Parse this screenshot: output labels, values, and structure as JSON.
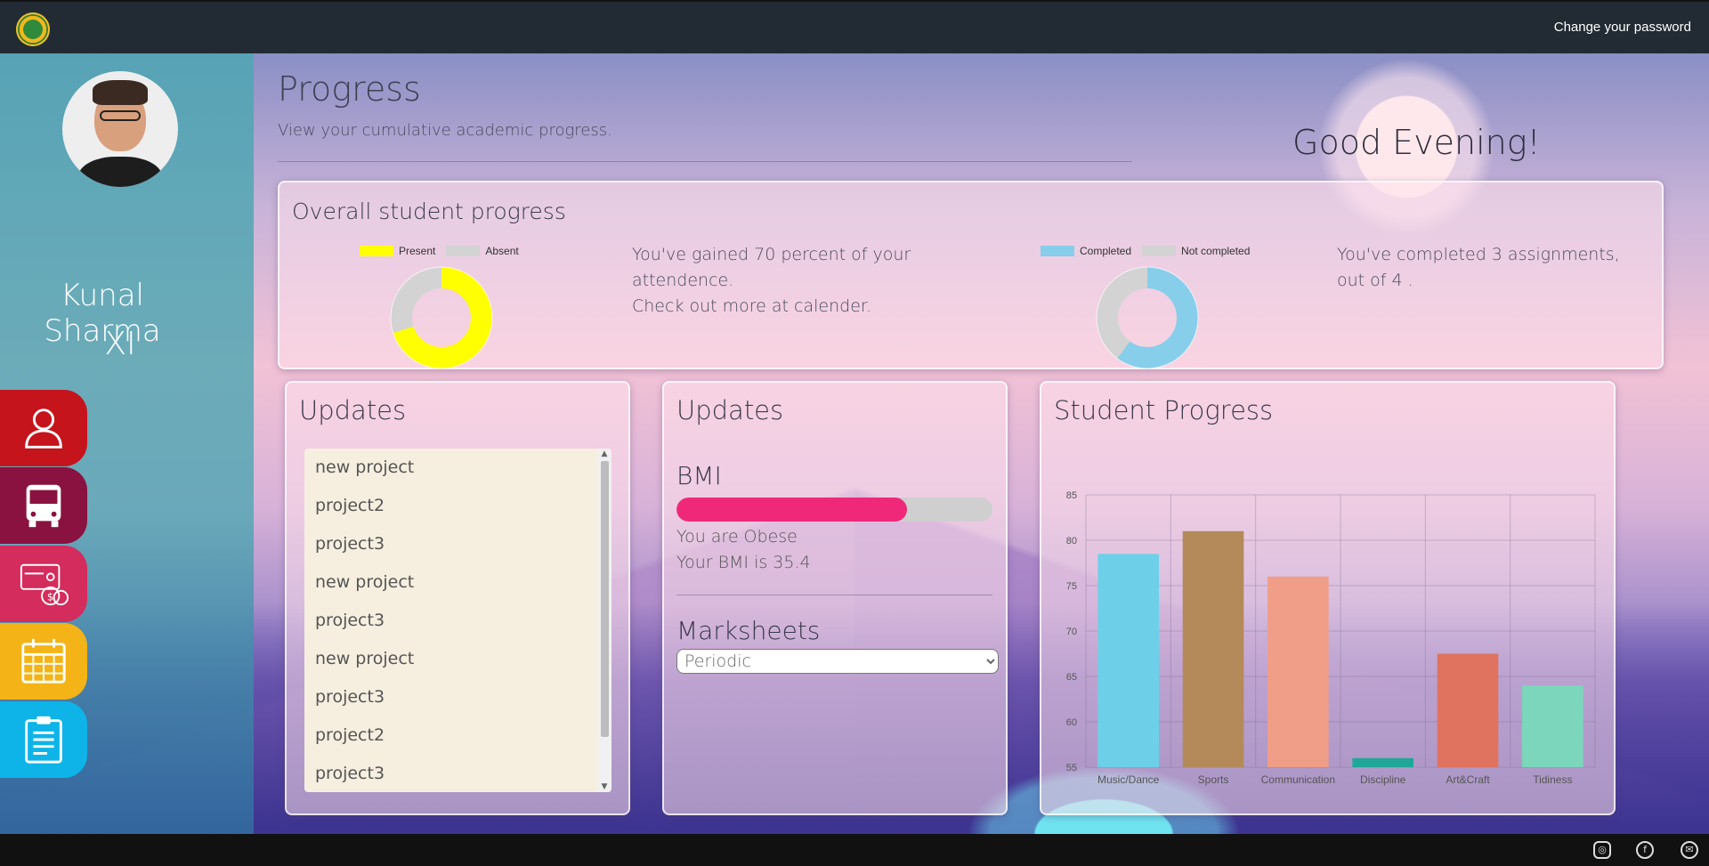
{
  "header": {
    "change_password": "Change your password"
  },
  "profile": {
    "name": "Kunal Sharma",
    "class": "XI"
  },
  "nav": [
    {
      "icon": "user-icon",
      "color": "#c5141c"
    },
    {
      "icon": "bus-icon",
      "color": "#8a1240"
    },
    {
      "icon": "fees-icon",
      "color": "#d42c5c"
    },
    {
      "icon": "calendar-icon",
      "color": "#f4b417"
    },
    {
      "icon": "clipboard-icon",
      "color": "#0eb4e8"
    }
  ],
  "page": {
    "title": "Progress",
    "subtitle": "View your cumulative academic progress.",
    "greeting": "Good Evening!"
  },
  "overall": {
    "title": "Overall student progress",
    "attendance": {
      "legend": [
        "Present",
        "Absent"
      ],
      "colors": [
        "#ffff00",
        "#d3d3d3"
      ],
      "present_fraction": 0.7,
      "line1": "You've gained 70 percent of your",
      "line2": "attendence.",
      "line3": "Check out more at calender."
    },
    "assignments": {
      "legend": [
        "Completed",
        "Not completed"
      ],
      "colors": [
        "#87ceeb",
        "#d3d3d3"
      ],
      "completed_fraction": 0.6,
      "line1": "You've completed 3 assignments,",
      "line2": "out of 4 ."
    }
  },
  "updates_panel": {
    "title": "Updates",
    "items": [
      "new project",
      "project2",
      "project3",
      "new project",
      "project3",
      "new project",
      "project3",
      "project2",
      "project3"
    ]
  },
  "health_panel": {
    "title": "Updates",
    "bmi_label": "BMI",
    "bmi_fill_fraction": 0.73,
    "bmi_status": "You are Obese",
    "bmi_value": "Your BMI is 35.4",
    "marksheets_label": "Marksheets",
    "marksheet_selected": "Periodic"
  },
  "progress_panel": {
    "title": "Student Progress"
  },
  "chart_data": {
    "type": "bar",
    "categories": [
      "Music/Dance",
      "Sports",
      "Communication",
      "Discipline",
      "Art&Craft",
      "Tidiness"
    ],
    "values": [
      78.5,
      81,
      76,
      56,
      67.5,
      64
    ],
    "colors": [
      "#6dd0e8",
      "#b48a5a",
      "#f09e88",
      "#1fa79a",
      "#e07260",
      "#7bd6bb"
    ],
    "ylim": [
      55,
      85
    ],
    "yticks": [
      55,
      60,
      65,
      70,
      75,
      80,
      85
    ],
    "grid": true
  },
  "footer": {
    "icons": [
      "instagram-icon",
      "facebook-icon",
      "mail-icon"
    ]
  }
}
